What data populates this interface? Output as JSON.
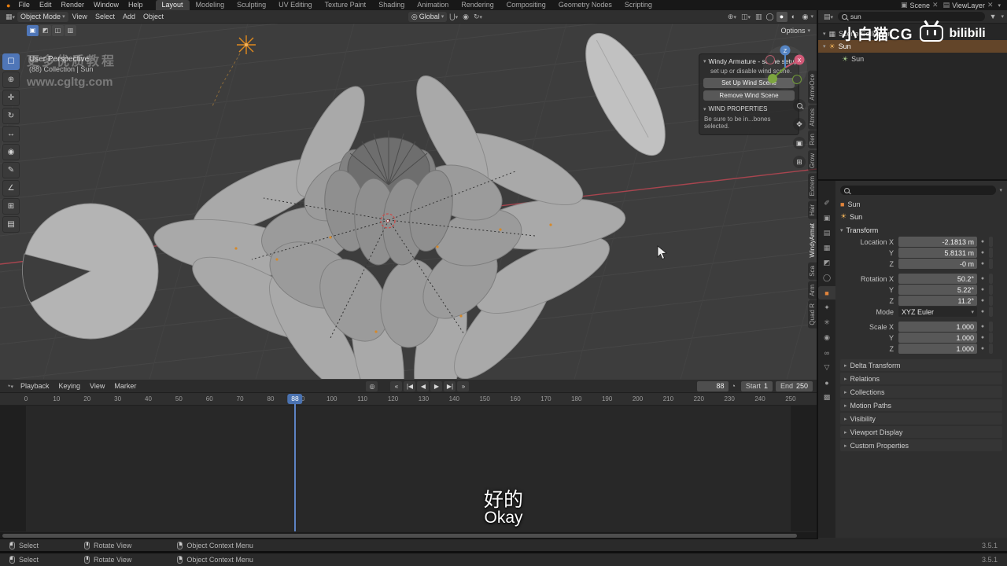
{
  "topbar": {
    "menus": [
      "File",
      "Edit",
      "Render",
      "Window",
      "Help"
    ],
    "tabs": [
      "Layout",
      "Modeling",
      "Sculpting",
      "UV Editing",
      "Texture Paint",
      "Shading",
      "Animation",
      "Rendering",
      "Compositing",
      "Geometry Nodes",
      "Scripting"
    ],
    "scene_label": "Scene",
    "viewlayer_label": "ViewLayer"
  },
  "viewport": {
    "mode": "Object Mode",
    "menus": [
      "View",
      "Select",
      "Add",
      "Object"
    ],
    "orientation": "Global",
    "options_label": "Options",
    "view_label": "User Perspective",
    "collection_label": "(88) Collection | Sun",
    "watermark_line1": "更多优质教程",
    "watermark_line2": "www.cgltg.com",
    "n_panel": {
      "title": "Windy Armature - scene setup",
      "subtitle": "set up or disable wind scene.",
      "button_setup": "Set Up Wind Scene",
      "button_remove": "Remove Wind Scene",
      "section": "WIND PROPERTIES",
      "note": "Be sure to be in...bones selected."
    },
    "side_tabs": [
      "ArmeOce",
      "Atmos",
      "Ren",
      "Grow",
      "Extrem",
      "Hair",
      "WindyArmat",
      "Sca",
      "Arm",
      "Quad R"
    ],
    "axis_x": "X",
    "axis_z": "Z"
  },
  "timeline": {
    "menus": [
      "Playback",
      "Keying",
      "View",
      "Marker"
    ],
    "current_frame": "88",
    "start_label": "Start",
    "start_value": "1",
    "end_label": "End",
    "end_value": "250",
    "ruler": [
      "0",
      "10",
      "20",
      "30",
      "40",
      "50",
      "60",
      "70",
      "80",
      "90",
      "100",
      "110",
      "120",
      "130",
      "140",
      "150",
      "160",
      "170",
      "180",
      "190",
      "200",
      "210",
      "220",
      "230",
      "240",
      "250"
    ]
  },
  "outliner": {
    "search": "sun",
    "root": "Scene Collection",
    "item_sun": "Sun",
    "item_sun_child": "Sun"
  },
  "bili": {
    "name": "小白猫CG",
    "logo_text": "bilibili"
  },
  "properties": {
    "breadcrumb": "Sun",
    "object_name": "Sun",
    "transform_title": "Transform",
    "loc_x_label": "Location X",
    "loc_x": "-2.1813 m",
    "loc_y_label": "Y",
    "loc_y": "5.8131 m",
    "loc_z_label": "Z",
    "loc_z": "-0 m",
    "rot_x_label": "Rotation X",
    "rot_x": "50.2°",
    "rot_y_label": "Y",
    "rot_y": "5.22°",
    "rot_z_label": "Z",
    "rot_z": "11.2°",
    "mode_label": "Mode",
    "mode_value": "XYZ Euler",
    "scale_x_label": "Scale X",
    "scale_x": "1.000",
    "scale_y_label": "Y",
    "scale_y": "1.000",
    "scale_z_label": "Z",
    "scale_z": "1.000",
    "sections": [
      "Delta Transform",
      "Relations",
      "Collections",
      "Motion Paths",
      "Visibility",
      "Viewport Display",
      "Custom Properties"
    ]
  },
  "statusbar": {
    "select": "Select",
    "rotate": "Rotate View",
    "context": "Object Context Menu",
    "version": "3.5.1"
  },
  "subtitles": {
    "cn": "好的",
    "en": "Okay"
  }
}
